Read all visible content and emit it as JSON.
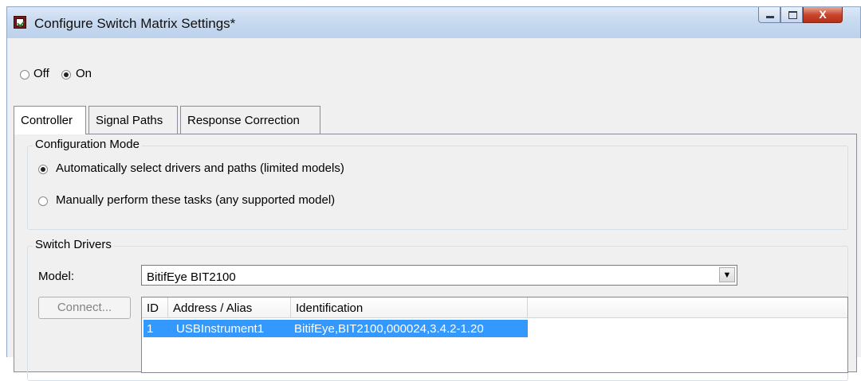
{
  "window": {
    "title": "Configure Switch Matrix Settings*",
    "close_glyph": "X"
  },
  "power": {
    "off_label": "Off",
    "on_label": "On",
    "selected": "On"
  },
  "tabs": [
    {
      "label": "Controller",
      "active": true
    },
    {
      "label": "Signal Paths",
      "active": false
    },
    {
      "label": "Response Correction",
      "active": false
    }
  ],
  "configuration_mode": {
    "legend": "Configuration Mode",
    "option_auto": "Automatically select drivers and paths (limited models)",
    "option_manual": "Manually perform these tasks (any supported model)",
    "selected": "auto"
  },
  "switch_drivers": {
    "legend": "Switch Drivers",
    "model_label": "Model:",
    "model_value": "BitifEye BIT2100",
    "connect_label": "Connect...",
    "columns": [
      "ID",
      "Address / Alias",
      "Identification"
    ],
    "rows": [
      {
        "id": "1",
        "alias": "USBInstrument1",
        "identification": "BitifEye,BIT2100,000024,3.4.2-1.20",
        "selected": true
      }
    ]
  },
  "icons": {
    "app": "app-checklist-icon",
    "minimize": "minimize-icon",
    "maximize": "maximize-icon",
    "close": "close-icon",
    "dropdown": "chevron-down-icon"
  }
}
